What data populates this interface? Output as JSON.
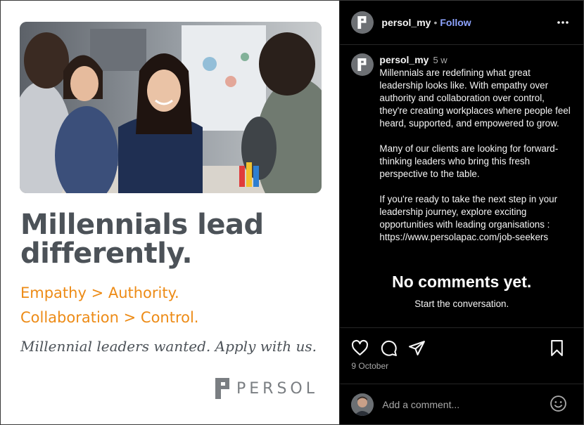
{
  "post_image": {
    "headline": "Millennials lead differently.",
    "tagline_1": "Empathy > Authority.",
    "tagline_2": "Collaboration > Control.",
    "cta": "Millennial leaders wanted. Apply with us.",
    "brand_name": "PERSOL",
    "colors": {
      "headline": "#4c5258",
      "accent": "#ed8b16",
      "background": "#ffffff"
    }
  },
  "header": {
    "username": "persol_my",
    "separator": "•",
    "follow_label": "Follow",
    "more_icon": "more-horizontal-icon"
  },
  "caption": {
    "username": "persol_my",
    "time": "5 w",
    "paragraphs": [
      "Millennials are redefining what great leadership looks like. With empathy over authority and collaboration over control, they're creating workplaces where people feel heard, supported, and empowered to grow.",
      "Many of our clients are looking for forward-thinking leaders who bring this fresh perspective to the table.",
      "If you're ready to take the next step in your leadership journey, explore exciting opportunities with leading organisations : https://www.persolapac.com/job-seekers"
    ]
  },
  "comments": {
    "empty_title": "No comments yet.",
    "empty_subtitle": "Start the conversation."
  },
  "actions": {
    "icons": [
      "heart-icon",
      "comment-icon",
      "share-icon",
      "bookmark-icon"
    ],
    "date": "9 October"
  },
  "comment_bar": {
    "placeholder": "Add a comment...",
    "emoji_icon": "emoji-icon"
  },
  "theme": {
    "follow_color": "#8ea4ff",
    "muted_text": "#a8a8a8",
    "divider": "#262626"
  }
}
